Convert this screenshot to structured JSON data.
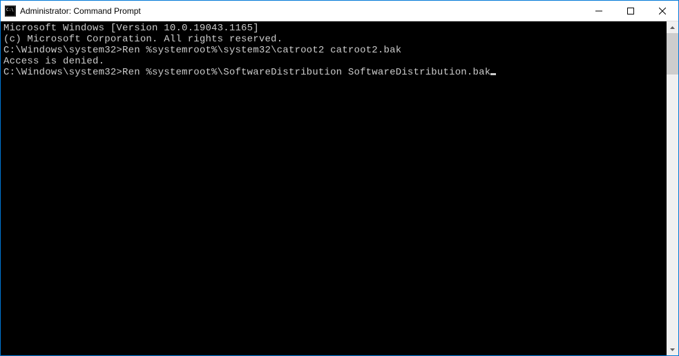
{
  "titlebar": {
    "title": "Administrator: Command Prompt"
  },
  "terminal": {
    "line1": "Microsoft Windows [Version 10.0.19043.1165]",
    "line2": "(c) Microsoft Corporation. All rights reserved.",
    "blank1": "",
    "prompt1_path": "C:\\Windows\\system32>",
    "prompt1_cmd": "Ren %systemroot%\\system32\\catroot2 catroot2.bak",
    "response1": "Access is denied.",
    "blank2": "",
    "prompt2_path": "C:\\Windows\\system32>",
    "prompt2_cmd": "Ren %systemroot%\\SoftwareDistribution SoftwareDistribution.bak"
  }
}
